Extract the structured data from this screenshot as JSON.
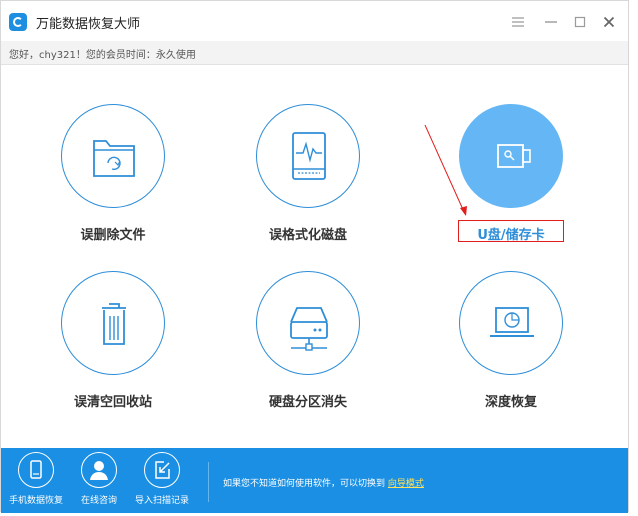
{
  "window": {
    "title": "万能数据恢复大师",
    "controls": [
      "menu-icon",
      "minimize-icon",
      "maximize-icon",
      "close-icon"
    ]
  },
  "account": {
    "greeting": "您好，chy321！您的会员时间：永久使用"
  },
  "tiles": [
    {
      "label": "误删除文件",
      "icon": "folder-recycle-icon"
    },
    {
      "label": "误格式化磁盘",
      "icon": "disk-pulse-icon"
    },
    {
      "label": "U盘/储存卡",
      "icon": "usb-drive-icon"
    },
    {
      "label": "误清空回收站",
      "icon": "trash-bin-icon"
    },
    {
      "label": "硬盘分区消失",
      "icon": "network-drive-icon"
    },
    {
      "label": "深度恢复",
      "icon": "laptop-scan-icon"
    }
  ],
  "footer": {
    "buttons": [
      {
        "label": "手机数据恢复",
        "icon": "phone-icon"
      },
      {
        "label": "在线咨询",
        "icon": "user-icon"
      },
      {
        "label": "导入扫描记录",
        "icon": "import-icon"
      }
    ],
    "hint": "如果您不知道如何使用软件，可以切换到",
    "hint_link": "向导模式"
  },
  "colors": {
    "accent": "#1a8fe3",
    "tile_border": "#2e8ed8",
    "active_fill": "#64b7f4",
    "annotation_red": "#e21d1d"
  }
}
